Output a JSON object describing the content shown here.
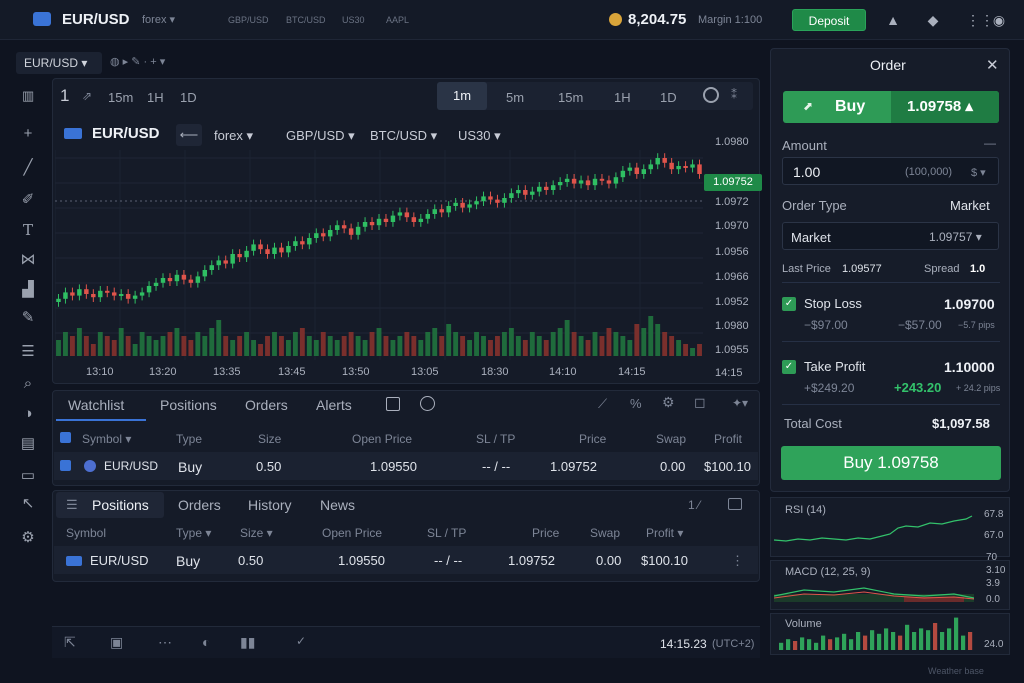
{
  "topbar": {
    "symbol": "EUR/USD",
    "category": "forex ▾",
    "tabs": [
      "GBP/USD",
      "BTC/USD",
      "US30",
      "AAPL"
    ],
    "balance": "8,204.75",
    "margin": "Margin 1:100",
    "deposit_label": "Deposit"
  },
  "toolbar": {
    "symbol_tab": "EUR/USD ▾",
    "quick_intervals": [
      "1",
      "15m",
      "1H",
      "1D"
    ],
    "timeframes": [
      "1m",
      "5m",
      "15m",
      "1H",
      "1D"
    ],
    "active_timeframe": "1m"
  },
  "chart_header": {
    "symbol": "EUR/USD",
    "category": "forex ▾",
    "tabs": [
      "GBP/USD ▾",
      "BTC/USD ▾",
      "US30 ▾"
    ]
  },
  "chart_data": {
    "type": "candlestick",
    "y_axis_labels": [
      "1.0980",
      "1.0972",
      "1.0970",
      "1.0956",
      "1.0966",
      "1.0952",
      "1.0980",
      "1.0955",
      "14:15"
    ],
    "x_axis_labels": [
      "13:10",
      "13:20",
      "13:35",
      "13:45",
      "13:50",
      "13:05",
      "18:30",
      "14:10",
      "14:15"
    ],
    "last_price": "1.09752",
    "closes": [
      0.12,
      0.16,
      0.14,
      0.18,
      0.15,
      0.13,
      0.17,
      0.16,
      0.14,
      0.15,
      0.12,
      0.14,
      0.16,
      0.2,
      0.22,
      0.25,
      0.23,
      0.27,
      0.24,
      0.22,
      0.26,
      0.3,
      0.33,
      0.36,
      0.34,
      0.4,
      0.38,
      0.42,
      0.46,
      0.43,
      0.4,
      0.44,
      0.41,
      0.45,
      0.48,
      0.46,
      0.5,
      0.53,
      0.51,
      0.55,
      0.58,
      0.56,
      0.52,
      0.57,
      0.6,
      0.58,
      0.62,
      0.6,
      0.64,
      0.66,
      0.63,
      0.6,
      0.62,
      0.65,
      0.68,
      0.66,
      0.7,
      0.72,
      0.69,
      0.71,
      0.73,
      0.76,
      0.74,
      0.72,
      0.75,
      0.78,
      0.8,
      0.77,
      0.79,
      0.82,
      0.8,
      0.83,
      0.85,
      0.87,
      0.84,
      0.86,
      0.83,
      0.87,
      0.86,
      0.84,
      0.88,
      0.92,
      0.94,
      0.9,
      0.93,
      0.96,
      1.0,
      0.97,
      0.93,
      0.95,
      0.94,
      0.96,
      0.9
    ],
    "volumes": [
      0.4,
      0.6,
      0.5,
      0.7,
      0.5,
      0.3,
      0.6,
      0.5,
      0.4,
      0.7,
      0.5,
      0.3,
      0.6,
      0.5,
      0.4,
      0.5,
      0.6,
      0.7,
      0.5,
      0.4,
      0.6,
      0.5,
      0.7,
      0.9,
      0.5,
      0.4,
      0.5,
      0.6,
      0.4,
      0.3,
      0.5,
      0.6,
      0.5,
      0.4,
      0.6,
      0.7,
      0.5,
      0.4,
      0.6,
      0.5,
      0.4,
      0.5,
      0.6,
      0.5,
      0.4,
      0.6,
      0.7,
      0.5,
      0.4,
      0.5,
      0.6,
      0.5,
      0.4,
      0.6,
      0.7,
      0.5,
      0.8,
      0.6,
      0.5,
      0.4,
      0.6,
      0.5,
      0.4,
      0.5,
      0.6,
      0.7,
      0.5,
      0.4,
      0.6,
      0.5,
      0.4,
      0.6,
      0.7,
      0.9,
      0.6,
      0.5,
      0.4,
      0.6,
      0.5,
      0.7,
      0.6,
      0.5,
      0.4,
      0.8,
      0.7,
      1.0,
      0.8,
      0.6,
      0.5,
      0.4,
      0.3,
      0.2,
      0.3
    ]
  },
  "watchlist": {
    "tabs": [
      "Watchlist",
      "Positions",
      "Orders",
      "Alerts"
    ],
    "active_tab": "Watchlist",
    "headers": [
      "Symbol ▾",
      "Type",
      "Size",
      "Open Price",
      "SL / TP",
      "Price",
      "Swap",
      "Profit"
    ],
    "row": {
      "symbol": "EUR/USD",
      "type": "Buy",
      "size": "0.50",
      "open": "1.09550",
      "sltp": "-- / --",
      "price": "1.09752",
      "swap": "0.00",
      "profit": "$100.10"
    }
  },
  "positions": {
    "tabs": [
      "Positions",
      "Orders",
      "History",
      "News"
    ],
    "active_tab": "Positions",
    "counter": "1 ⁄",
    "headers": [
      "Symbol",
      "Type ▾",
      "Size ▾",
      "Open Price",
      "SL / TP",
      "Price",
      "Swap",
      "Profit ▾"
    ],
    "row": {
      "symbol": "EUR/USD",
      "type": "Buy",
      "size": "0.50",
      "open": "1.09550",
      "sltp": "-- / --",
      "price": "1.09752",
      "swap": "0.00",
      "profit": "$100.10"
    }
  },
  "status": {
    "time": "14:15.23",
    "tz": "(UTC+2)"
  },
  "order": {
    "title": "Order",
    "buy_label": "Buy",
    "buy_price": "1.09758 ▴",
    "amount_label": "Amount",
    "amount_value": "1.00",
    "amount_units": "(100,000)",
    "amount_currency": "$ ▾",
    "order_type_label": "Order Type",
    "order_type_value": "Market",
    "market_label": "Market",
    "market_price": "1.09757 ▾",
    "last_price_label": "Last Price",
    "last_price": "1.09577",
    "spread_label": "Spread",
    "spread_value": "1.0",
    "stop_loss_label": "Stop Loss",
    "stop_loss_value": "1.09700",
    "stop_loss_sub1": "−$97.00",
    "stop_loss_sub2": "−$57.00",
    "stop_loss_pips": "−5.7 pips",
    "take_profit_label": "Take Profit",
    "take_profit_value": "1.10000",
    "take_profit_sub1": "+$249.20",
    "take_profit_sub2": "+243.20",
    "take_profit_pips": "+ 24.2 pips",
    "total_cost_label": "Total Cost",
    "total_cost_value": "$1,097.58",
    "buy_big_label": "Buy  1.09758"
  },
  "indicators": {
    "rsi_label": "RSI (14)",
    "rsi_vals": [
      "67.8",
      "67.0",
      "70"
    ],
    "macd_label": "MACD (12, 25, 9)",
    "macd_vals": [
      "3.10",
      "3.9",
      "0.0"
    ],
    "volume_label": "Volume",
    "volume_val": "24.0",
    "footer": "Weather base"
  }
}
